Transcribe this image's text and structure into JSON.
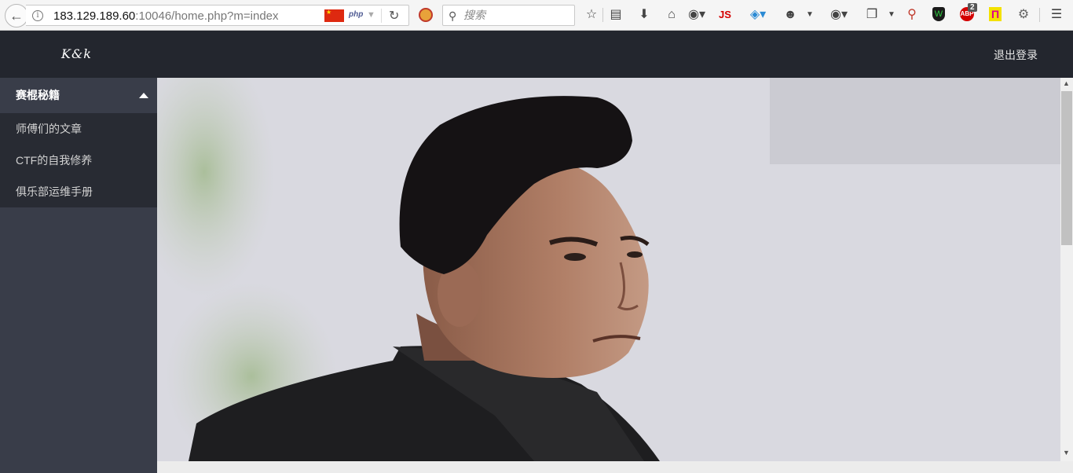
{
  "browser": {
    "url_host": "183.129.189.60",
    "url_rest": ":10046/home.php?m=index",
    "php_badge": "php",
    "search_placeholder": "搜索",
    "js_label": "JS",
    "abp_label": "ABP",
    "abp_count": "2",
    "pi_label": "Π"
  },
  "header": {
    "brand": "K&k",
    "logout_label": "退出登录"
  },
  "sidebar": {
    "group_title": "赛棍秘籍",
    "items": [
      {
        "label": "师傅们的文章"
      },
      {
        "label": "CTF的自我修养"
      },
      {
        "label": "俱乐部运维手册"
      }
    ]
  },
  "colors": {
    "header_bg": "#23262e",
    "sidebar_bg": "#393d49",
    "submenu_bg": "#282b33"
  }
}
